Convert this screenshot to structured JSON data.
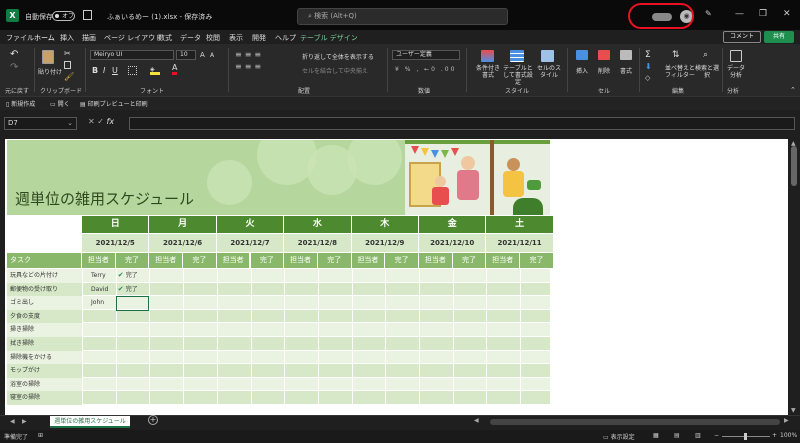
{
  "titlebar": {
    "logo": "X",
    "autosave_label": "自動保存",
    "autosave_state": "オフ",
    "save_icon": "save-icon",
    "filename": "ふぁいるめー (1).xlsx - 保存済み",
    "search_placeholder": "検索 (Alt+Q)",
    "window_controls": [
      "—",
      "❐",
      "✕"
    ]
  },
  "menu": {
    "items": [
      "ファイル",
      "ホーム",
      "挿入",
      "描画",
      "ページ レイアウト",
      "数式",
      "データ",
      "校閲",
      "表示",
      "開発",
      "ヘルプ",
      "テーブル デザイン"
    ],
    "active": "ホーム",
    "comment_label": "コメント",
    "share_label": "共有"
  },
  "ribbon": {
    "undo_group": "元に戻す",
    "clipboard_group": "クリップボード",
    "paste_label": "貼り付け",
    "font_group": "フォント",
    "font_name": "Meiryo UI",
    "font_size": "10",
    "alignment_group": "配置",
    "wrap_text": "折り返して全体を表示する",
    "merge_center": "セルを結合して中央揃え",
    "number_group": "数値",
    "number_format": "ユーザー定義",
    "styles_group": "スタイル",
    "cond_format": "条件付き書式",
    "format_as_table": "テーブルとして書式設定",
    "cell_styles": "セルのスタイル",
    "cells_group": "セル",
    "insert": "挿入",
    "delete": "削除",
    "format": "書式",
    "editing_group": "編集",
    "sort_filter": "並べ替えとフィルター",
    "find_select": "検索と選択",
    "analysis_group": "分析",
    "data_analysis": "データ分析"
  },
  "qat": {
    "new": "新規作成",
    "open": "開く",
    "print_preview": "印刷プレビューと印刷"
  },
  "formula": {
    "namebox": "D7",
    "fx": "fx",
    "content": ""
  },
  "sheet": {
    "title": "週単位の雑用スケジュール",
    "days": [
      "日",
      "月",
      "火",
      "水",
      "木",
      "金",
      "土"
    ],
    "dates": [
      "2021/12/5",
      "2021/12/6",
      "2021/12/7",
      "2021/12/8",
      "2021/12/9",
      "2021/12/10",
      "2021/12/11"
    ],
    "task_header": "タスク",
    "assignee_label": "担当者",
    "done_label": "完了",
    "tasks": [
      {
        "name": "玩具などの片付け",
        "who": "Terry",
        "done": "完了"
      },
      {
        "name": "郵便物の受け取り",
        "who": "David",
        "done": "完了"
      },
      {
        "name": "ゴミ出し",
        "who": "John",
        "done": ""
      },
      {
        "name": "夕食の支度",
        "who": "",
        "done": ""
      },
      {
        "name": "掃き掃除",
        "who": "",
        "done": ""
      },
      {
        "name": "拭き掃除",
        "who": "",
        "done": ""
      },
      {
        "name": "掃除機をかける",
        "who": "",
        "done": ""
      },
      {
        "name": "モップがけ",
        "who": "",
        "done": ""
      },
      {
        "name": "浴室の掃除",
        "who": "",
        "done": ""
      },
      {
        "name": "寝室の掃除",
        "who": "",
        "done": ""
      }
    ]
  },
  "tabs": {
    "sheet_tab": "週単位の雑用スケジュール",
    "add": "+"
  },
  "status": {
    "ready": "準備完了",
    "display_settings": "表示設定",
    "zoom": "100%"
  }
}
